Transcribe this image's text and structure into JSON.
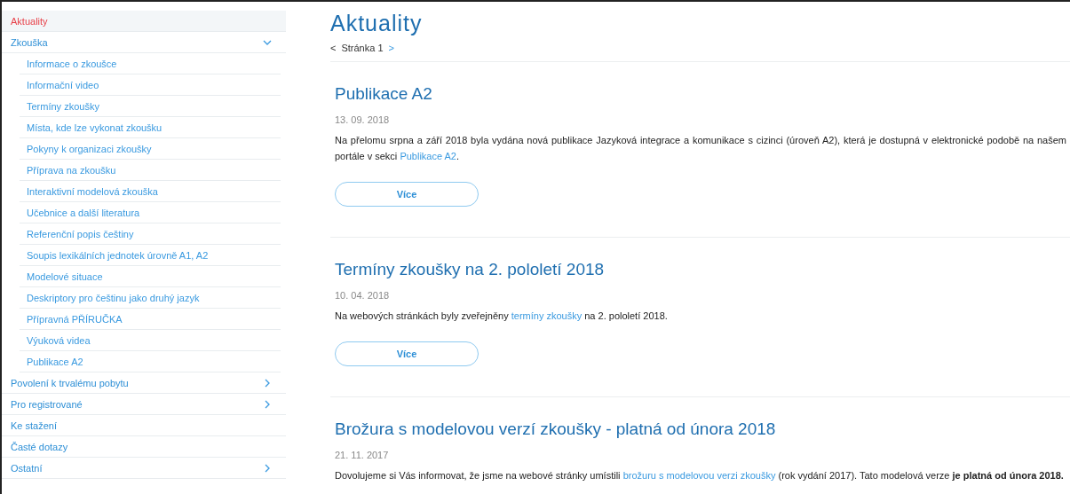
{
  "sidebar": {
    "items": [
      {
        "label": "Aktuality",
        "kind": "link",
        "selected": true
      },
      {
        "label": "Zkouška",
        "kind": "group",
        "selected": false,
        "expanded": true,
        "children": [
          {
            "label": "Informace o zkoušce",
            "selected": false
          },
          {
            "label": "Informační video",
            "selected": false
          },
          {
            "label": "Termíny zkoušky",
            "selected": false
          },
          {
            "label": "Místa, kde lze vykonat zkoušku",
            "selected": false
          },
          {
            "label": "Pokyny k organizaci zkoušky",
            "selected": false
          },
          {
            "label": "Příprava na zkoušku",
            "selected": false
          },
          {
            "label": "Interaktivní modelová zkouška",
            "selected": false
          },
          {
            "label": "Učebnice a další literatura",
            "selected": false
          },
          {
            "label": "Referenční popis češtiny",
            "selected": false
          },
          {
            "label": "Soupis lexikálních jednotek úrovně A1, A2",
            "selected": false
          },
          {
            "label": "Modelové situace",
            "selected": false
          },
          {
            "label": "Deskriptory pro češtinu jako druhý jazyk",
            "selected": false
          },
          {
            "label": "Přípravná PŘÍRUČKA",
            "selected": false
          },
          {
            "label": "Výuková videa",
            "selected": false
          },
          {
            "label": "Publikace A2",
            "selected": false
          }
        ]
      },
      {
        "label": "Povolení k trvalému pobytu",
        "kind": "group",
        "selected": false,
        "expanded": false
      },
      {
        "label": "Pro registrované",
        "kind": "group",
        "selected": false,
        "expanded": false
      },
      {
        "label": "Ke stažení",
        "kind": "link",
        "selected": false
      },
      {
        "label": "Časté dotazy",
        "kind": "link",
        "selected": false
      },
      {
        "label": "Ostatní",
        "kind": "group",
        "selected": false,
        "expanded": false
      }
    ]
  },
  "page": {
    "title": "Aktuality",
    "pager": {
      "prev": "<",
      "label": "Stránka 1",
      "next": ">"
    }
  },
  "articles": [
    {
      "title": "Publikace A2",
      "date": "13. 09. 2018",
      "body": [
        {
          "kind": "text",
          "text": "Na přelomu srpna a září 2018 byla vydána nová publikace Jazyková integrace a komunikace s cizinci (úroveň A2), která je dostupná v elektronické podobě na našem portále v sekci "
        },
        {
          "kind": "link",
          "text": "Publikace A2"
        },
        {
          "kind": "text",
          "text": "."
        }
      ],
      "button": "Více"
    },
    {
      "title": "Termíny zkoušky na 2. pololetí 2018",
      "date": "10. 04. 2018",
      "body": [
        {
          "kind": "text",
          "text": "Na webových stránkách byly zveřejněny "
        },
        {
          "kind": "link",
          "text": "termíny zkoušky"
        },
        {
          "kind": "text",
          "text": " na 2. pololetí 2018."
        }
      ],
      "button": "Více"
    },
    {
      "title": "Brožura s modelovou verzí zkoušky - platná od února 2018",
      "date": "21. 11. 2017",
      "body": [
        {
          "kind": "text",
          "text": "Dovolujeme si Vás informovat, že jsme na webové stránky umístili "
        },
        {
          "kind": "link",
          "text": "brožuru s modelovou verzi zkoušky"
        },
        {
          "kind": "text",
          "text": " (rok vydání 2017). Tato modelová verze "
        },
        {
          "kind": "bold",
          "text": "je platná od února 2018."
        }
      ]
    }
  ]
}
